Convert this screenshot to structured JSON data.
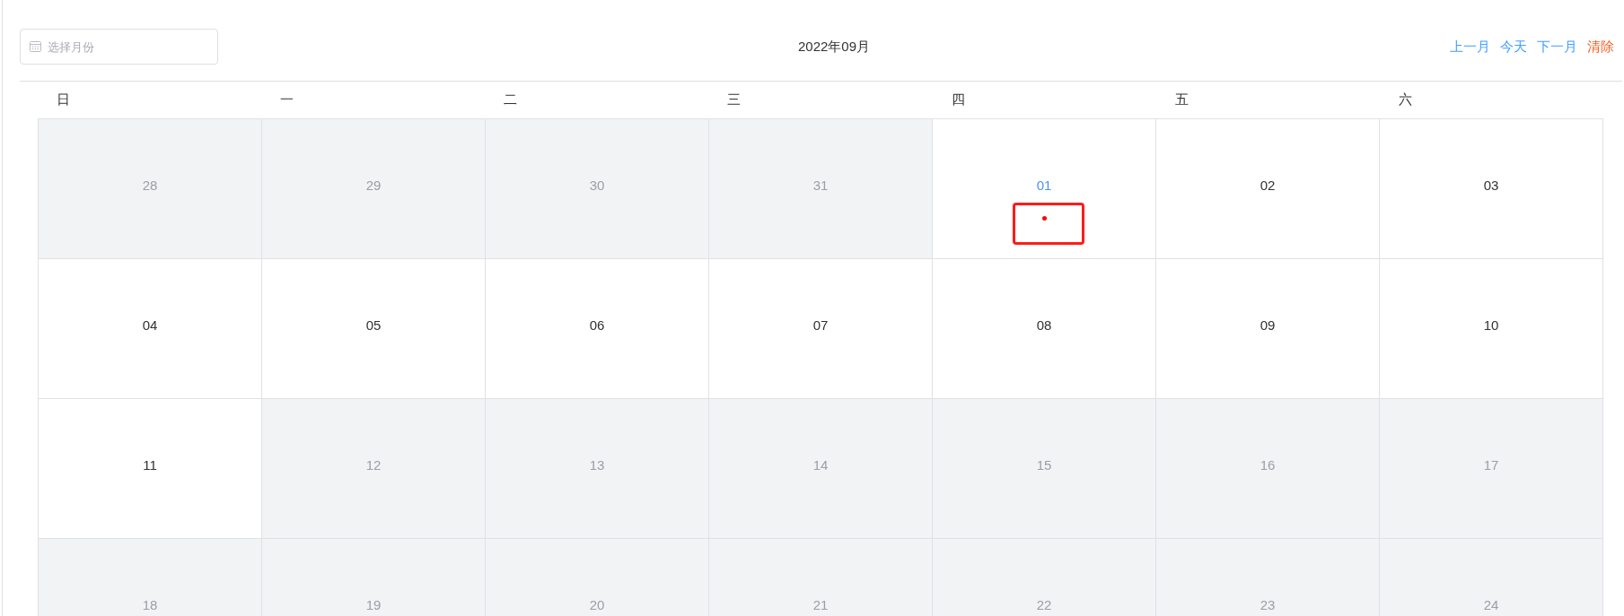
{
  "month_picker": {
    "placeholder": "选择月份"
  },
  "title": "2022年09月",
  "actions": [
    {
      "label": "上一月",
      "kind": "nav"
    },
    {
      "label": "今天",
      "kind": "nav"
    },
    {
      "label": "下一月",
      "kind": "nav"
    },
    {
      "label": "清除",
      "kind": "clear"
    }
  ],
  "weekdays": [
    "日",
    "一",
    "二",
    "三",
    "四",
    "五",
    "六"
  ],
  "weeks": [
    [
      {
        "day": "28",
        "disabled": true,
        "selected": false,
        "has_event": false,
        "highlighted": false
      },
      {
        "day": "29",
        "disabled": true,
        "selected": false,
        "has_event": false,
        "highlighted": false
      },
      {
        "day": "30",
        "disabled": true,
        "selected": false,
        "has_event": false,
        "highlighted": false
      },
      {
        "day": "31",
        "disabled": true,
        "selected": false,
        "has_event": false,
        "highlighted": false
      },
      {
        "day": "01",
        "disabled": false,
        "selected": true,
        "has_event": true,
        "highlighted": true
      },
      {
        "day": "02",
        "disabled": false,
        "selected": false,
        "has_event": false,
        "highlighted": false
      },
      {
        "day": "03",
        "disabled": false,
        "selected": false,
        "has_event": false,
        "highlighted": false
      }
    ],
    [
      {
        "day": "04",
        "disabled": false,
        "selected": false,
        "has_event": false,
        "highlighted": false
      },
      {
        "day": "05",
        "disabled": false,
        "selected": false,
        "has_event": false,
        "highlighted": false
      },
      {
        "day": "06",
        "disabled": false,
        "selected": false,
        "has_event": false,
        "highlighted": false
      },
      {
        "day": "07",
        "disabled": false,
        "selected": false,
        "has_event": false,
        "highlighted": false
      },
      {
        "day": "08",
        "disabled": false,
        "selected": false,
        "has_event": false,
        "highlighted": false
      },
      {
        "day": "09",
        "disabled": false,
        "selected": false,
        "has_event": false,
        "highlighted": false
      },
      {
        "day": "10",
        "disabled": false,
        "selected": false,
        "has_event": false,
        "highlighted": false
      }
    ],
    [
      {
        "day": "11",
        "disabled": false,
        "selected": false,
        "has_event": false,
        "highlighted": false
      },
      {
        "day": "12",
        "disabled": true,
        "selected": false,
        "has_event": false,
        "highlighted": false
      },
      {
        "day": "13",
        "disabled": true,
        "selected": false,
        "has_event": false,
        "highlighted": false
      },
      {
        "day": "14",
        "disabled": true,
        "selected": false,
        "has_event": false,
        "highlighted": false
      },
      {
        "day": "15",
        "disabled": true,
        "selected": false,
        "has_event": false,
        "highlighted": false
      },
      {
        "day": "16",
        "disabled": true,
        "selected": false,
        "has_event": false,
        "highlighted": false
      },
      {
        "day": "17",
        "disabled": true,
        "selected": false,
        "has_event": false,
        "highlighted": false
      }
    ],
    [
      {
        "day": "18",
        "disabled": true,
        "selected": false,
        "has_event": false,
        "highlighted": false
      },
      {
        "day": "19",
        "disabled": true,
        "selected": false,
        "has_event": false,
        "highlighted": false
      },
      {
        "day": "20",
        "disabled": true,
        "selected": false,
        "has_event": false,
        "highlighted": false
      },
      {
        "day": "21",
        "disabled": true,
        "selected": false,
        "has_event": false,
        "highlighted": false
      },
      {
        "day": "22",
        "disabled": true,
        "selected": false,
        "has_event": false,
        "highlighted": false
      },
      {
        "day": "23",
        "disabled": true,
        "selected": false,
        "has_event": false,
        "highlighted": false
      },
      {
        "day": "24",
        "disabled": true,
        "selected": false,
        "has_event": false,
        "highlighted": false
      }
    ]
  ]
}
